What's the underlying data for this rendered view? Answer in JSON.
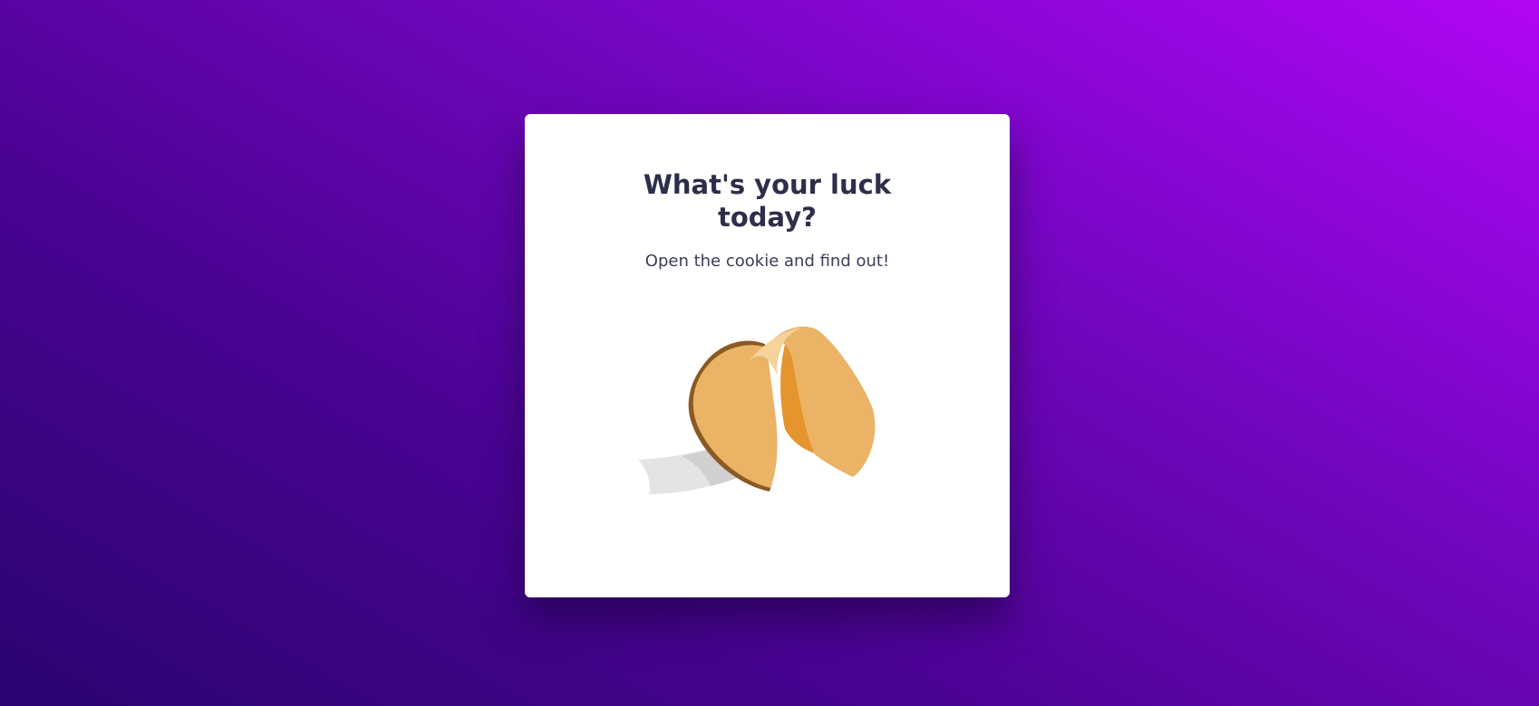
{
  "card": {
    "title": "What's your luck today?",
    "subtitle": "Open the cookie and find out!"
  },
  "cookie": {
    "icon": "fortune-cookie-icon",
    "colors": {
      "cookie": "#ebb365",
      "cookie_dark": "#e5952e",
      "cookie_shadow": "#8a5a22",
      "cookie_highlight": "#f6d39a",
      "paper": "#e4e4e4",
      "paper_shade": "#d0d0d0"
    }
  },
  "colors": {
    "background_start": "#2a0470",
    "background_end": "#b106f5",
    "card": "#ffffff",
    "text": "#2c2e4a"
  }
}
